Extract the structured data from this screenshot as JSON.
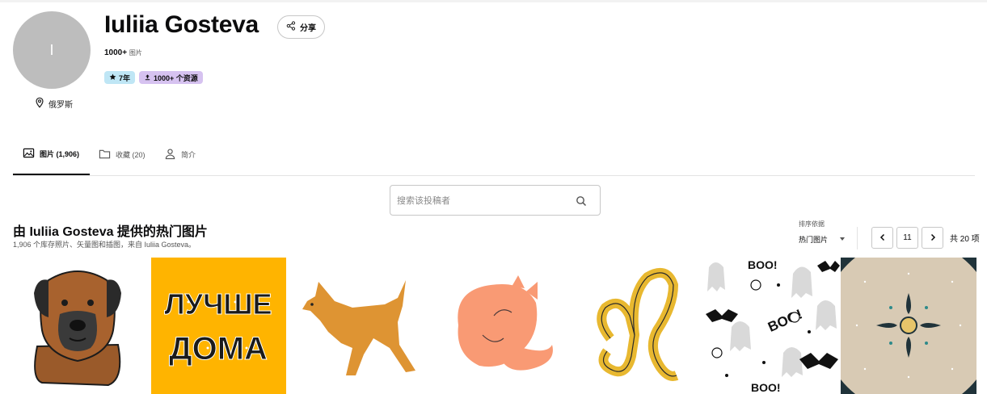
{
  "profile": {
    "avatar_initial": "I",
    "name": "Iuliia Gosteva",
    "location": "俄罗斯",
    "count_number": "1000+",
    "count_unit": "图片",
    "badges": {
      "years": "7年",
      "assets": "1000+ 个资源"
    }
  },
  "actions": {
    "share_label": "分享"
  },
  "tabs": [
    {
      "label": "图片 (1,906)",
      "active": true,
      "icon": "image-icon"
    },
    {
      "label": "收藏 (20)",
      "active": false,
      "icon": "folder-icon"
    },
    {
      "label": "简介",
      "active": false,
      "icon": "user-icon"
    }
  ],
  "search": {
    "placeholder": "搜索该投稿者"
  },
  "section": {
    "title": "由 Iuliia Gosteva 提供的热门图片",
    "subtitle": "1,906 个库存照片、矢量图和插图，来自 Iuliia Gosteva。"
  },
  "sort": {
    "label": "排序依据",
    "value": "热门图片"
  },
  "pagination": {
    "current": "11",
    "total_label": "共 20 项"
  },
  "colors": {
    "accent_yellow": "#ffb400",
    "badge_blue": "#bfe6f5",
    "badge_purple": "#d6c2f0"
  },
  "thumbnails": [
    {
      "subject": "dog-portrait"
    },
    {
      "subject": "lettering",
      "line1": "ЛУЧШЕ",
      "line2": "ДОМА"
    },
    {
      "subject": "walking-dog"
    },
    {
      "subject": "sleeping-cat"
    },
    {
      "subject": "leo-zodiac"
    },
    {
      "subject": "halloween-pattern",
      "words": [
        "BOO!",
        "BOO!",
        "BOO!"
      ]
    },
    {
      "subject": "ornament-pattern"
    }
  ]
}
